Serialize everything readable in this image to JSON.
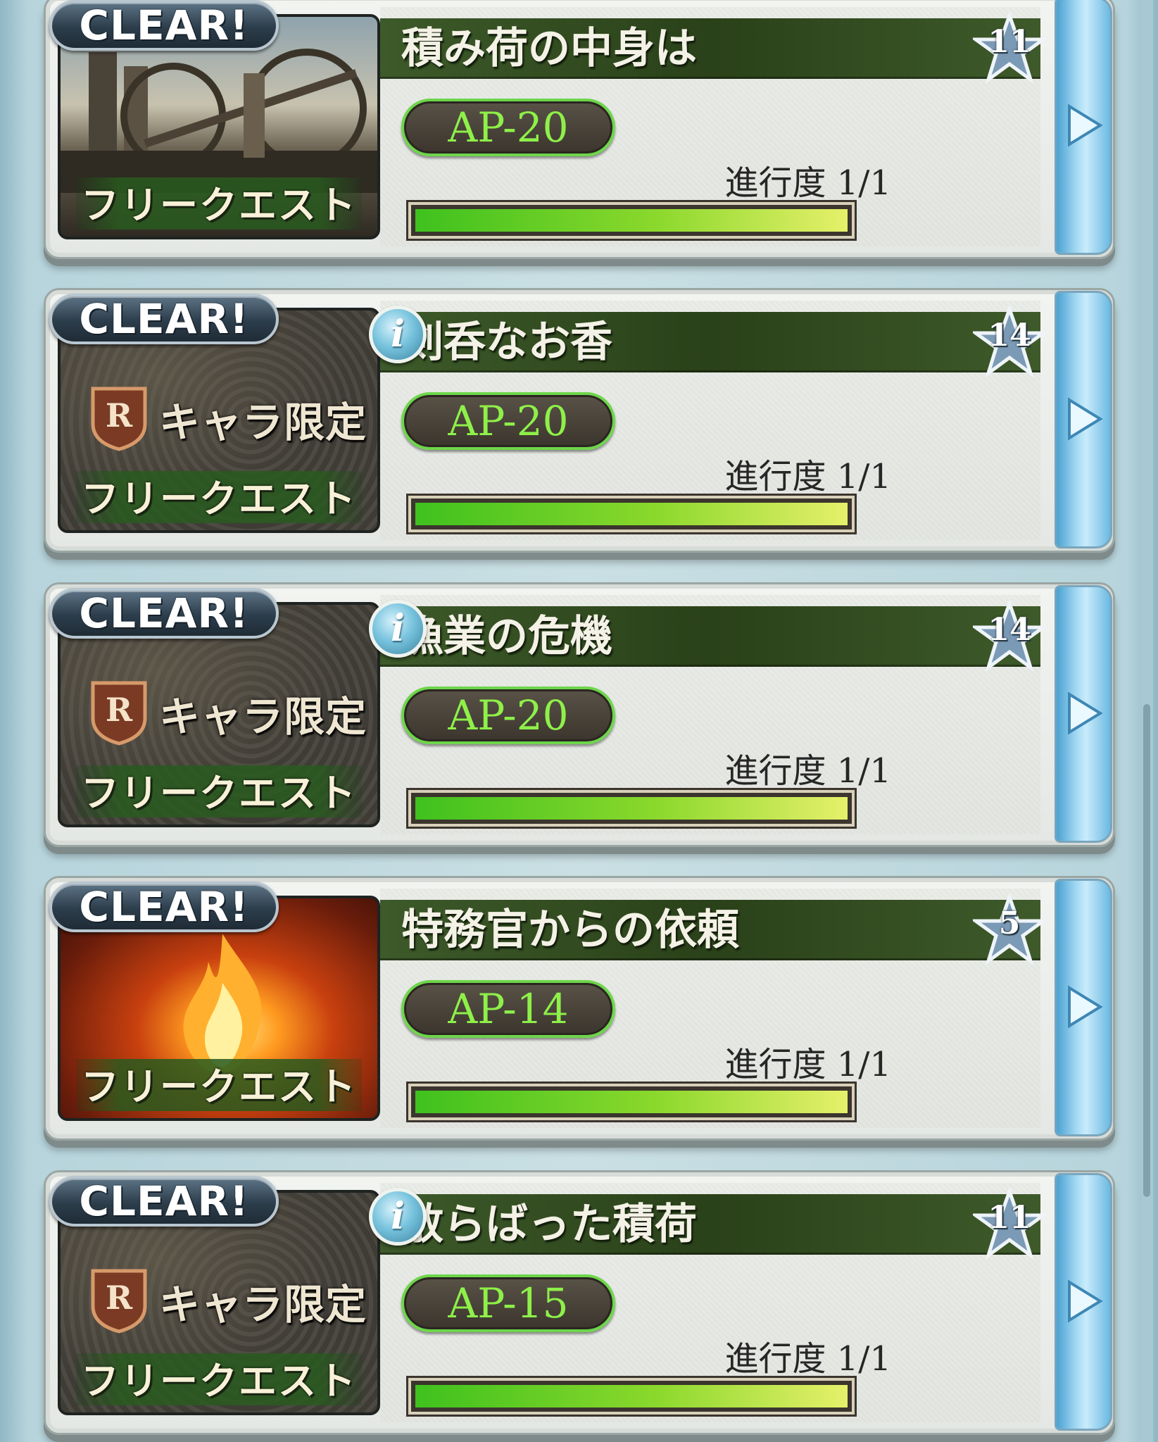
{
  "quests": [
    {
      "clear_label": "CLEAR!",
      "title": "積み荷の中身は",
      "difficulty": "11",
      "ap": "AP-20",
      "progress": "進行度 1/1",
      "progress_fraction": 1.0,
      "thumb_type": "scene-industrial",
      "limited_label": "",
      "free_quest_label": "フリークエスト",
      "has_info": false
    },
    {
      "clear_label": "CLEAR!",
      "title": "剣呑なお香",
      "difficulty": "14",
      "ap": "AP-20",
      "progress": "進行度 1/1",
      "progress_fraction": 1.0,
      "thumb_type": "scene-limited",
      "limited_label": "キャラ限定",
      "free_quest_label": "フリークエスト",
      "has_info": true
    },
    {
      "clear_label": "CLEAR!",
      "title": "漁業の危機",
      "difficulty": "14",
      "ap": "AP-20",
      "progress": "進行度 1/1",
      "progress_fraction": 1.0,
      "thumb_type": "scene-limited",
      "limited_label": "キャラ限定",
      "free_quest_label": "フリークエスト",
      "has_info": true
    },
    {
      "clear_label": "CLEAR!",
      "title": "特務官からの依頼",
      "difficulty": "5",
      "ap": "AP-14",
      "progress": "進行度 1/1",
      "progress_fraction": 1.0,
      "thumb_type": "scene-fire",
      "limited_label": "",
      "free_quest_label": "フリークエスト",
      "has_info": false
    },
    {
      "clear_label": "CLEAR!",
      "title": "散らばった積荷",
      "difficulty": "11",
      "ap": "AP-15",
      "progress": "進行度 1/1",
      "progress_fraction": 1.0,
      "thumb_type": "scene-limited",
      "limited_label": "キャラ限定",
      "free_quest_label": "フリークエスト",
      "has_info": true
    }
  ],
  "icons": {
    "info": "i",
    "emblem": "R"
  },
  "colors": {
    "title_bar": "#2a4119",
    "ap_text": "#8ef049",
    "ap_border": "#6dd64a",
    "progress_start": "#3fc11e",
    "progress_end": "#e6f06a",
    "go_button": "#9fd6f1"
  }
}
